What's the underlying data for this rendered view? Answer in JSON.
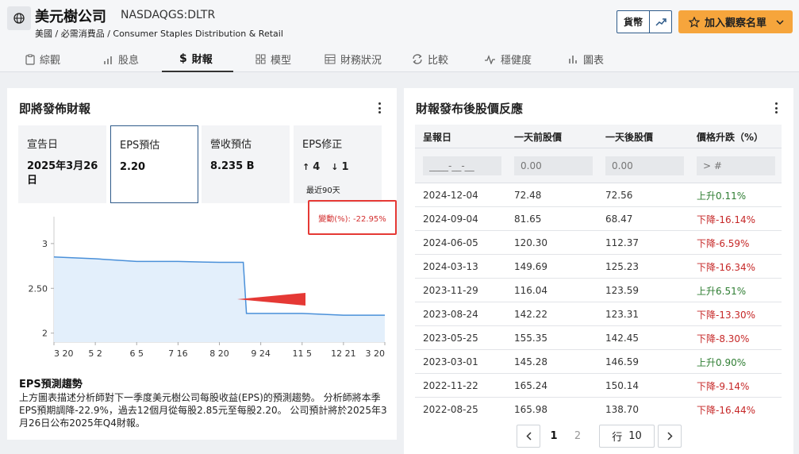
{
  "header": {
    "company": "美元樹公司",
    "ticker": "NASDAQGS:DLTR",
    "subtitle": "美國 / 必需消費品 / Consumer Staples Distribution & Retail",
    "currency_label": "貨幣",
    "watchlist_label": "加入觀察名單"
  },
  "tabs": [
    {
      "label": "綜觀",
      "icon": "clipboard-icon"
    },
    {
      "label": "股息",
      "icon": "bar-up-icon"
    },
    {
      "label": "財報",
      "icon": "dollar-icon",
      "active": true
    },
    {
      "label": "模型",
      "icon": "grid-icon"
    },
    {
      "label": "財務狀況",
      "icon": "table-icon"
    },
    {
      "label": "比較",
      "icon": "swap-icon"
    },
    {
      "label": "穩健度",
      "icon": "pulse-icon"
    },
    {
      "label": "圖表",
      "icon": "bars-icon"
    }
  ],
  "upcoming": {
    "title": "即將發佈財報",
    "cards": [
      {
        "label": "宣告日",
        "value": "2025年3月26日"
      },
      {
        "label": "EPS預估",
        "value": "2.20"
      },
      {
        "label": "營收預估",
        "value": "8.235 B"
      },
      {
        "label": "EPS修正",
        "up": "4",
        "down": "1",
        "note": "最近90天"
      }
    ],
    "annotation": "變動(%): -22.95%",
    "trend_title": "EPS預測趨勢",
    "trend_text": "上方圖表描述分析師對下一季度美元樹公司每股收益(EPS)的預測趨勢。 分析師將本季EPS預期調降-22.9%，過去12個月從每股2.85元至每股2.20。 公司預計將於2025年3月26日公布2025年Q4財報。"
  },
  "chart_data": {
    "type": "area",
    "title": "",
    "xlabel": "",
    "ylabel": "",
    "ylim": [
      1.9,
      3.3
    ],
    "yticks": [
      "3",
      "2.50",
      "2"
    ],
    "xticks": [
      "3 20",
      "5 2",
      "6 5",
      "7 16",
      "8 20",
      "9 24",
      "11 5",
      "12 21",
      "3 20"
    ],
    "series": [
      {
        "x": [
          "3 20",
          "5 2",
          "6 5",
          "7 16",
          "8 20",
          "9 24",
          "11 5",
          "12 21",
          "3 20"
        ],
        "values": [
          2.85,
          2.83,
          2.8,
          2.8,
          2.79,
          2.22,
          2.22,
          2.2,
          2.2
        ]
      }
    ],
    "fill_color": "#e3effb",
    "line_color": "#4a90d9"
  },
  "reaction": {
    "title": "財報發布後股價反應",
    "columns": [
      "呈報日",
      "一天前股價",
      "一天後股價",
      "價格升跌（%）"
    ],
    "filters": [
      "____-__-__",
      "0.00",
      "0.00",
      "> #"
    ],
    "rows": [
      {
        "date": "2024-12-04",
        "before": "72.48",
        "after": "72.56",
        "change": "上升0.11%",
        "dir": "up"
      },
      {
        "date": "2024-09-04",
        "before": "81.65",
        "after": "68.47",
        "change": "下降-16.14%",
        "dir": "down"
      },
      {
        "date": "2024-06-05",
        "before": "120.30",
        "after": "112.37",
        "change": "下降-6.59%",
        "dir": "down"
      },
      {
        "date": "2024-03-13",
        "before": "149.69",
        "after": "125.23",
        "change": "下降-16.34%",
        "dir": "down"
      },
      {
        "date": "2023-11-29",
        "before": "116.04",
        "after": "123.59",
        "change": "上升6.51%",
        "dir": "up"
      },
      {
        "date": "2023-08-24",
        "before": "142.22",
        "after": "123.31",
        "change": "下降-13.30%",
        "dir": "down"
      },
      {
        "date": "2023-05-25",
        "before": "155.35",
        "after": "142.45",
        "change": "下降-8.30%",
        "dir": "down"
      },
      {
        "date": "2023-03-01",
        "before": "145.28",
        "after": "146.59",
        "change": "上升0.90%",
        "dir": "up"
      },
      {
        "date": "2022-11-22",
        "before": "165.24",
        "after": "150.14",
        "change": "下降-9.14%",
        "dir": "down"
      },
      {
        "date": "2022-08-25",
        "before": "165.98",
        "after": "138.70",
        "change": "下降-16.44%",
        "dir": "down"
      }
    ],
    "pager": {
      "page1": "1",
      "page2": "2",
      "rows_label": "行",
      "rows_value": "10"
    }
  },
  "colors": {
    "accent": "#f6a53c",
    "up": "#2e7d32",
    "down": "#c62828",
    "annotation": "#e53935"
  }
}
